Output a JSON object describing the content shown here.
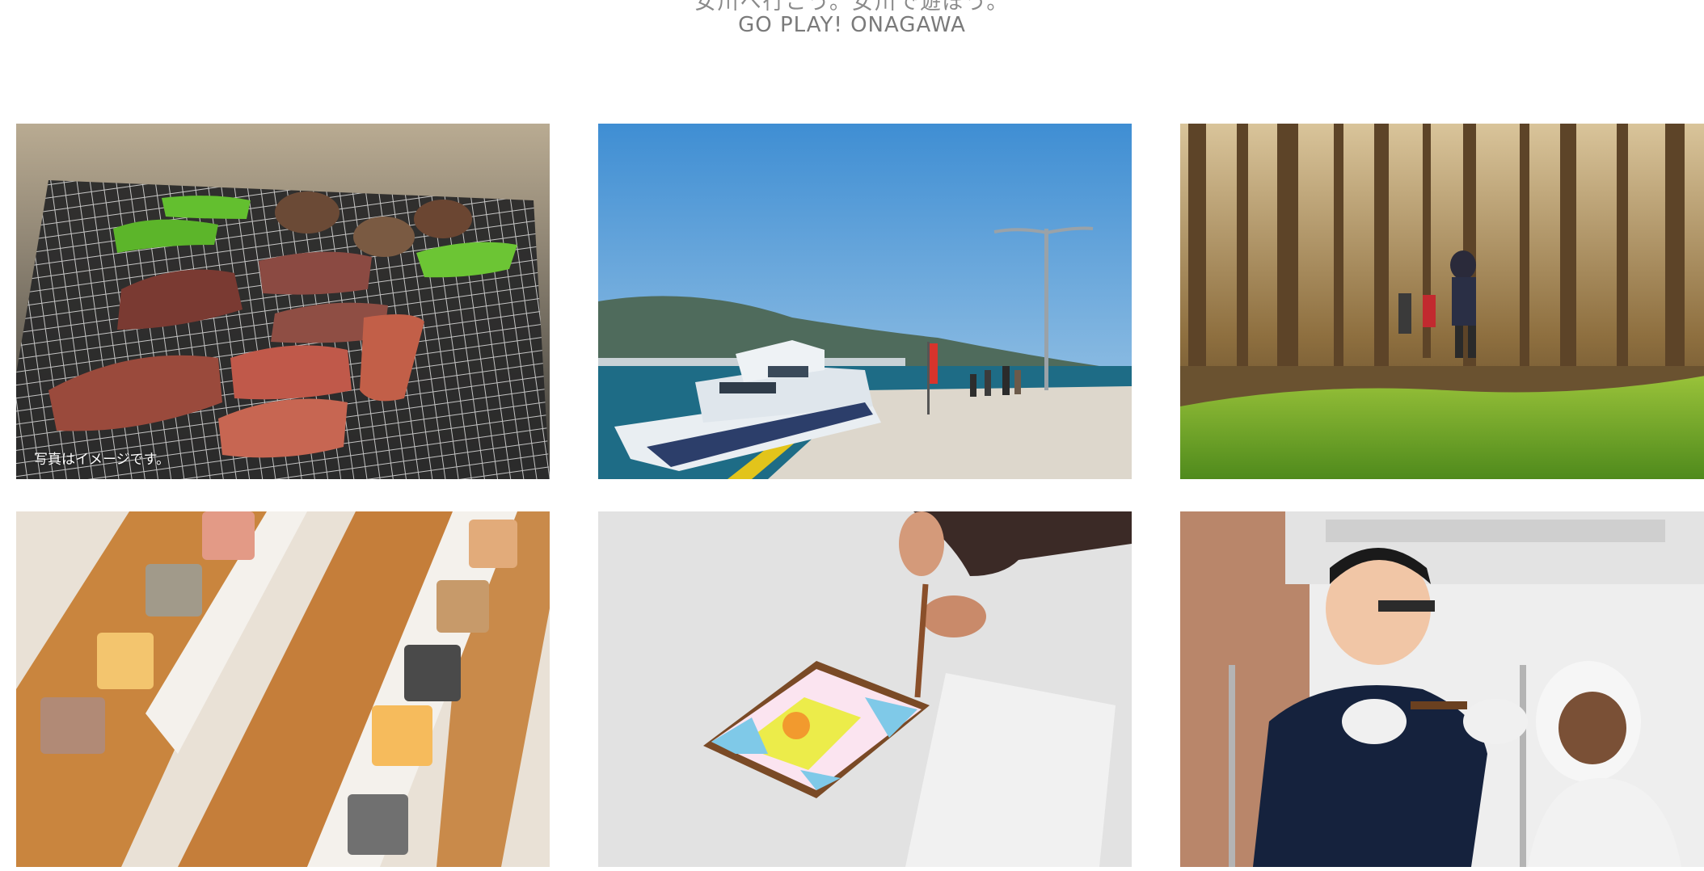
{
  "header": {
    "title_jp": "女川へ行こう。女川で遊ぼう。",
    "title_en": "GO PLAY! ONAGAWA"
  },
  "gallery": {
    "tiles": [
      {
        "icon": "bbq-grill-photo",
        "caption": "写真はイメージです。"
      },
      {
        "icon": "ferry-pier-photo"
      },
      {
        "icon": "forest-hike-photo"
      },
      {
        "icon": "soap-samples-photo"
      },
      {
        "icon": "tile-painting-photo"
      },
      {
        "icon": "factory-tasting-photo"
      }
    ]
  },
  "colors": {
    "header_text": "#7a7a7a",
    "sky": "#5fa6de",
    "sea": "#1d5f7a",
    "moss": "#6fa62a",
    "wood": "#c98a4a"
  }
}
